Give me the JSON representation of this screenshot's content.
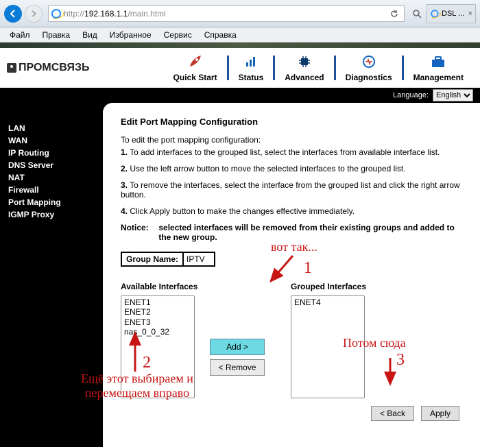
{
  "browser": {
    "url_scheme": "http://",
    "url_host": "192.168.1.1",
    "url_path": "/main.html",
    "tab_title": "DSL ..."
  },
  "menu": [
    "Файл",
    "Правка",
    "Вид",
    "Избранное",
    "Сервис",
    "Справка"
  ],
  "logo_text": "ПРОМСВЯЗЬ",
  "topnav": [
    {
      "label": "Quick Start"
    },
    {
      "label": "Status"
    },
    {
      "label": "Advanced"
    },
    {
      "label": "Diagnostics"
    },
    {
      "label": "Management"
    }
  ],
  "language": {
    "label": "Language:",
    "value": "English"
  },
  "sidebar": [
    "LAN",
    "WAN",
    "IP Routing",
    "DNS Server",
    "NAT",
    "Firewall",
    "Port Mapping",
    "IGMP Proxy"
  ],
  "page": {
    "title": "Edit Port Mapping Configuration",
    "intro": "To edit the port mapping configuration:",
    "steps": [
      "To add interfaces to the grouped list, select the interfaces from available interface list.",
      "Use the left arrow button to move the selected interfaces to the grouped list.",
      "To remove the interfaces, select the interface from the grouped list and click the right arrow button.",
      "Click Apply button to make the changes effective immediately."
    ],
    "notice_label": "Notice:",
    "notice": "selected interfaces will be removed from their existing groups and added to the new group.",
    "group_name_label": "Group Name:",
    "group_name_value": "IPTV",
    "available_title": "Available Interfaces",
    "grouped_title": "Grouped Interfaces",
    "available": [
      "ENET1",
      "ENET2",
      "ENET3",
      "nas_0_0_32"
    ],
    "grouped": [
      "ENET4"
    ],
    "add_btn": "Add  >",
    "remove_btn": "<  Remove",
    "back_btn": "< Back",
    "apply_btn": "Apply"
  },
  "annotations": {
    "a1_text": "вот так...",
    "a1_num": "1",
    "a2_num": "2",
    "a2_text1": "Ещё этот выбираем и",
    "a2_text2": "перемещаем вправо",
    "a3_text": "Потом сюда",
    "a3_num": "3"
  }
}
